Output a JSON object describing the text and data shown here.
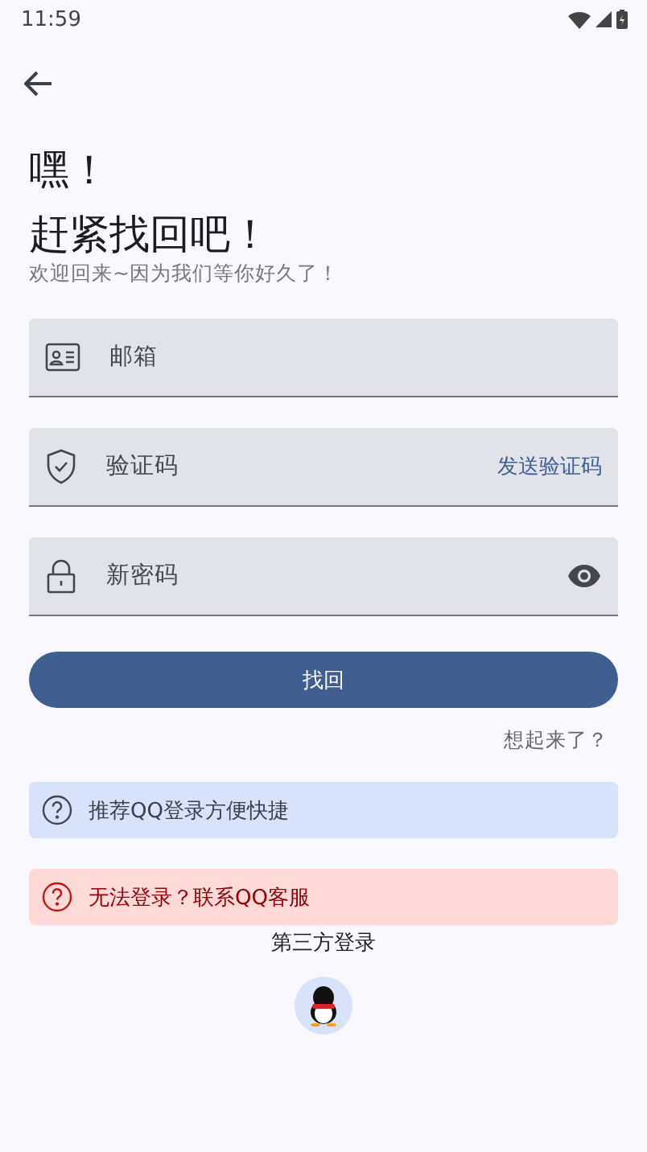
{
  "status_bar": {
    "time": "11:59"
  },
  "title_lines": [
    "嘿！",
    "赶紧找回吧！"
  ],
  "subtitle": "欢迎回来~因为我们等你好久了！",
  "fields": [
    {
      "kind": "email",
      "placeholder": "邮箱"
    },
    {
      "kind": "code",
      "placeholder": "验证码",
      "action": "发送验证码"
    },
    {
      "kind": "password",
      "placeholder": "新密码"
    }
  ],
  "submit_button": "找回",
  "remember_link": "想起来了？",
  "notices": [
    {
      "kind": "info",
      "text": "推荐QQ登录方便快捷"
    },
    {
      "kind": "error",
      "text": "无法登录？联系QQ客服"
    }
  ],
  "third_party": {
    "label": "第三方登录"
  }
}
